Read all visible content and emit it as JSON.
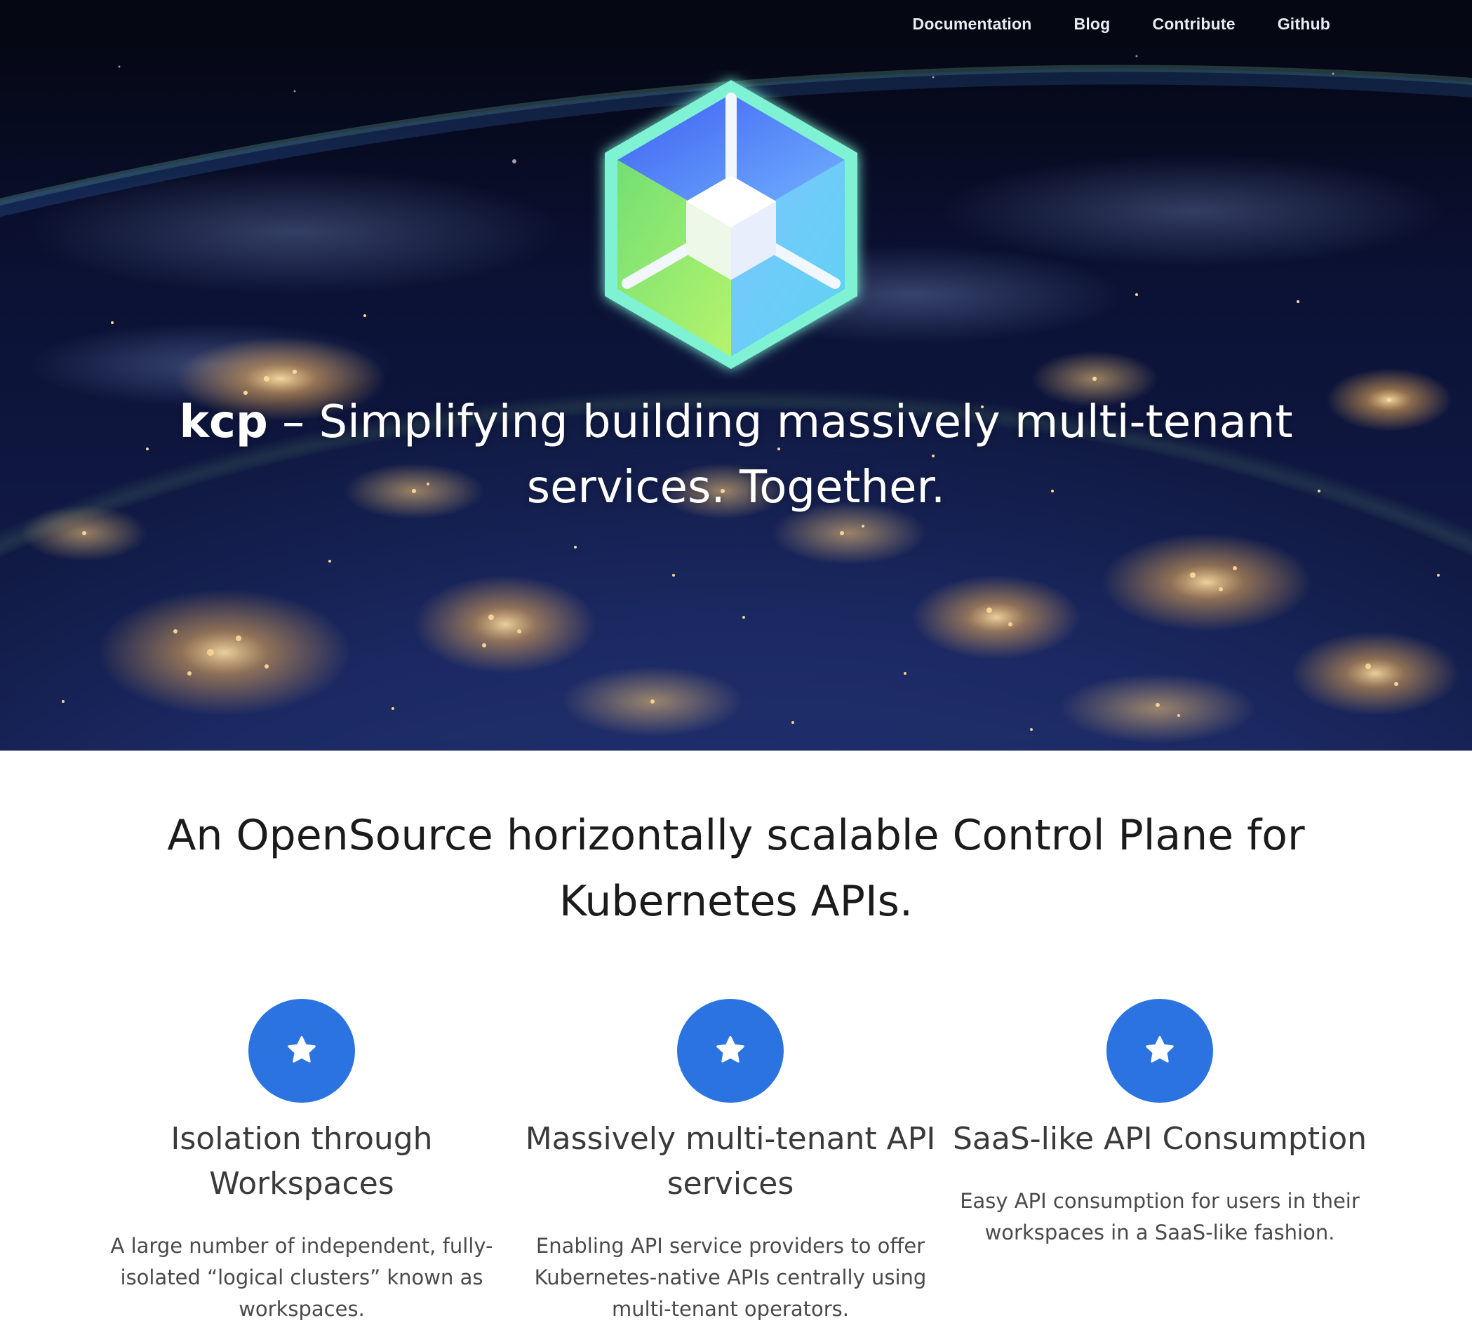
{
  "nav": {
    "items": [
      {
        "label": "Documentation"
      },
      {
        "label": "Blog"
      },
      {
        "label": "Contribute"
      },
      {
        "label": "Github"
      }
    ]
  },
  "hero": {
    "brand": "kcp",
    "title_rest": " – Simplifying building massively multi-tenant services. Together.",
    "logo_icon": "kcp-hexagon-cube-logo",
    "background": "earth-at-night-from-space"
  },
  "main": {
    "tagline": "An OpenSource horizontally scalable Control Plane for Kubernetes APIs.",
    "features": [
      {
        "icon": "star-icon",
        "title": "Isolation through Workspaces",
        "description": "A large number of independent, fully-isolated “logical clusters” known as workspaces."
      },
      {
        "icon": "star-icon",
        "title": "Massively multi-tenant API services",
        "description": "Enabling API service providers to offer Kubernetes-native APIs centrally using multi-tenant operators."
      },
      {
        "icon": "star-icon",
        "title": "SaaS-like API Consumption",
        "description": "Easy API consumption for users in their workspaces in a SaaS-like fashion."
      }
    ]
  },
  "colors": {
    "accent": "#2a73e0",
    "nav_background": "#050814",
    "logo_glow": "#6ef0d0"
  }
}
